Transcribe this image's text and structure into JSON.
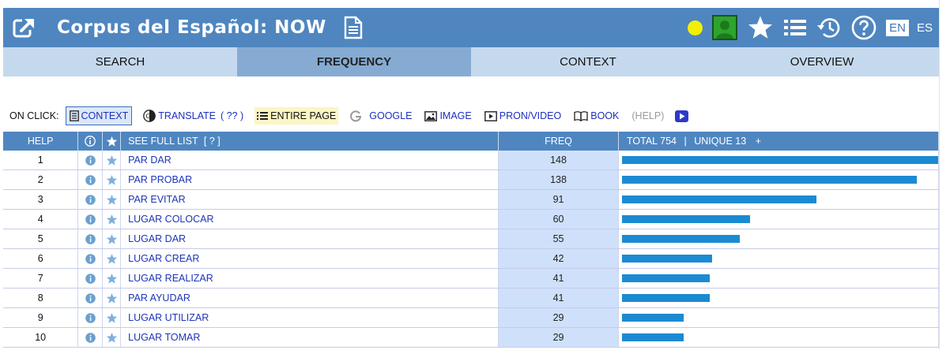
{
  "header": {
    "title": "Corpus del Español: NOW",
    "lang_en": "EN",
    "lang_es": "ES",
    "colors": {
      "header_bg": "#4f86c0",
      "status_dot": "#f2f000",
      "user_box": "#2ea42e"
    },
    "icons": [
      "external-link-icon",
      "document-icon",
      "user-icon",
      "star-icon",
      "list-icon",
      "history-icon",
      "help-icon"
    ]
  },
  "tabs": [
    {
      "label": "SEARCH",
      "active": false
    },
    {
      "label": "FREQUENCY",
      "active": true
    },
    {
      "label": "CONTEXT",
      "active": false
    },
    {
      "label": "OVERVIEW",
      "active": false
    }
  ],
  "onclick": {
    "label": "ON CLICK:",
    "context": "CONTEXT",
    "translate": "TRANSLATE",
    "translate_q": "( ?? )",
    "entire_page": "ENTIRE PAGE",
    "google": "GOOGLE",
    "image": "IMAGE",
    "pron_video": "PRON/VIDEO",
    "book": "BOOK",
    "help": "(HELP)"
  },
  "table": {
    "headers": {
      "help": "HELP",
      "see_full_list": "SEE FULL LIST",
      "see_full_list_q": "[ ? ]",
      "freq": "FREQ",
      "total": "TOTAL 754",
      "sep": "|",
      "unique": "UNIQUE 13",
      "plus": "+"
    },
    "max_freq": 148,
    "rows": [
      {
        "rank": "1",
        "word": "PAR DAR",
        "freq": "148"
      },
      {
        "rank": "2",
        "word": "PAR PROBAR",
        "freq": "138"
      },
      {
        "rank": "3",
        "word": "PAR EVITAR",
        "freq": "91"
      },
      {
        "rank": "4",
        "word": "LUGAR COLOCAR",
        "freq": "60"
      },
      {
        "rank": "5",
        "word": "LUGAR DAR",
        "freq": "55"
      },
      {
        "rank": "6",
        "word": "LUGAR CREAR",
        "freq": "42"
      },
      {
        "rank": "7",
        "word": "LUGAR REALIZAR",
        "freq": "41"
      },
      {
        "rank": "8",
        "word": "PAR AYUDAR",
        "freq": "41"
      },
      {
        "rank": "9",
        "word": "LUGAR UTILIZAR",
        "freq": "29"
      },
      {
        "rank": "10",
        "word": "LUGAR TOMAR",
        "freq": "29"
      }
    ]
  }
}
